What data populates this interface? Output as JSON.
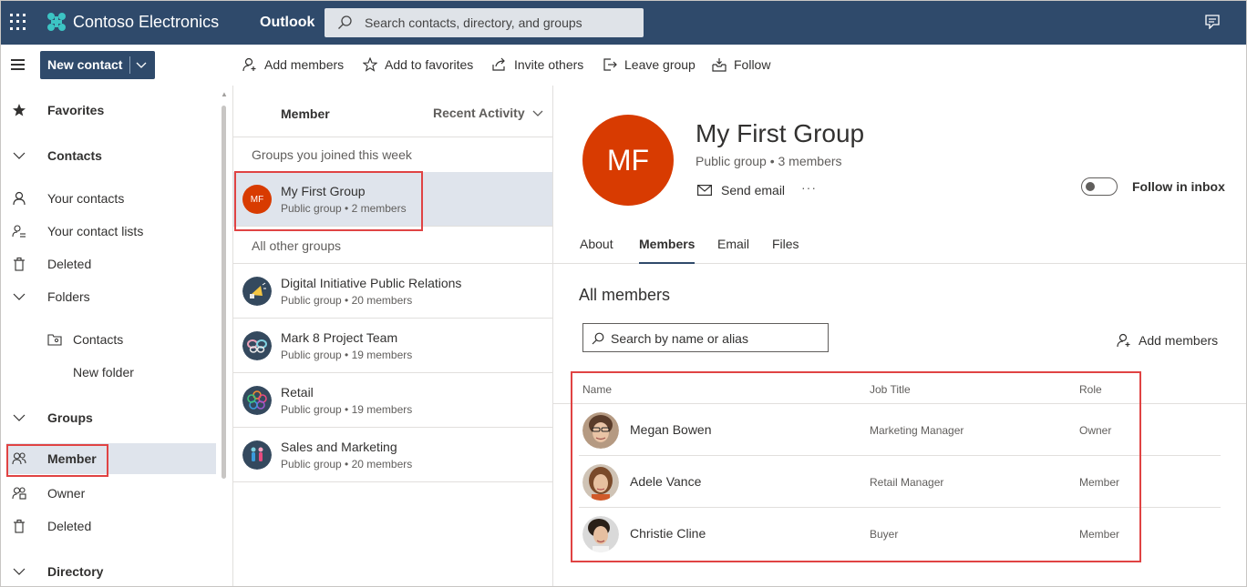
{
  "topbar": {
    "brand": "Contoso Electronics",
    "app": "Outlook",
    "search_placeholder": "Search contacts, directory, and groups"
  },
  "commands": {
    "new_contact": "New contact",
    "add_members": "Add members",
    "add_to_favorites": "Add to favorites",
    "invite_others": "Invite others",
    "leave_group": "Leave group",
    "follow": "Follow"
  },
  "nav": {
    "favorites": "Favorites",
    "contacts": "Contacts",
    "your_contacts": "Your contacts",
    "your_contact_lists": "Your contact lists",
    "deleted": "Deleted",
    "folders": "Folders",
    "folder_contacts": "Contacts",
    "new_folder": "New folder",
    "groups": "Groups",
    "member": "Member",
    "owner": "Owner",
    "groups_deleted": "Deleted",
    "directory": "Directory"
  },
  "group_list": {
    "header": "Member",
    "sort": "Recent Activity",
    "section_joined": "Groups you joined this week",
    "section_other": "All other groups",
    "joined": [
      {
        "name": "My First Group",
        "meta": "Public group • 2 members",
        "initials": "MF"
      }
    ],
    "others": [
      {
        "name": "Digital Initiative Public Relations",
        "meta": "Public group • 20 members"
      },
      {
        "name": "Mark 8 Project Team",
        "meta": "Public group • 19 members"
      },
      {
        "name": "Retail",
        "meta": "Public group • 19 members"
      },
      {
        "name": "Sales and Marketing",
        "meta": "Public group • 20 members"
      }
    ]
  },
  "detail": {
    "initials": "MF",
    "title": "My First Group",
    "subtitle": "Public group • 3 members",
    "send_email": "Send email",
    "more": "···",
    "follow_in_inbox": "Follow in inbox",
    "follow_enabled": false,
    "tabs": [
      "About",
      "Members",
      "Email",
      "Files"
    ],
    "active_tab": "Members",
    "all_members": "All members",
    "member_search_placeholder": "Search by name or alias",
    "add_members": "Add members",
    "columns": {
      "name": "Name",
      "job": "Job Title",
      "role": "Role"
    },
    "members": [
      {
        "name": "Megan Bowen",
        "job": "Marketing Manager",
        "role": "Owner"
      },
      {
        "name": "Adele Vance",
        "job": "Retail Manager",
        "role": "Member"
      },
      {
        "name": "Christie Cline",
        "job": "Buyer",
        "role": "Member"
      }
    ]
  },
  "colors": {
    "brand_bar": "#2f4a6b",
    "accent_avatar": "#d83b01",
    "highlight": "#e04343",
    "selected_bg": "#dfe4ec"
  }
}
